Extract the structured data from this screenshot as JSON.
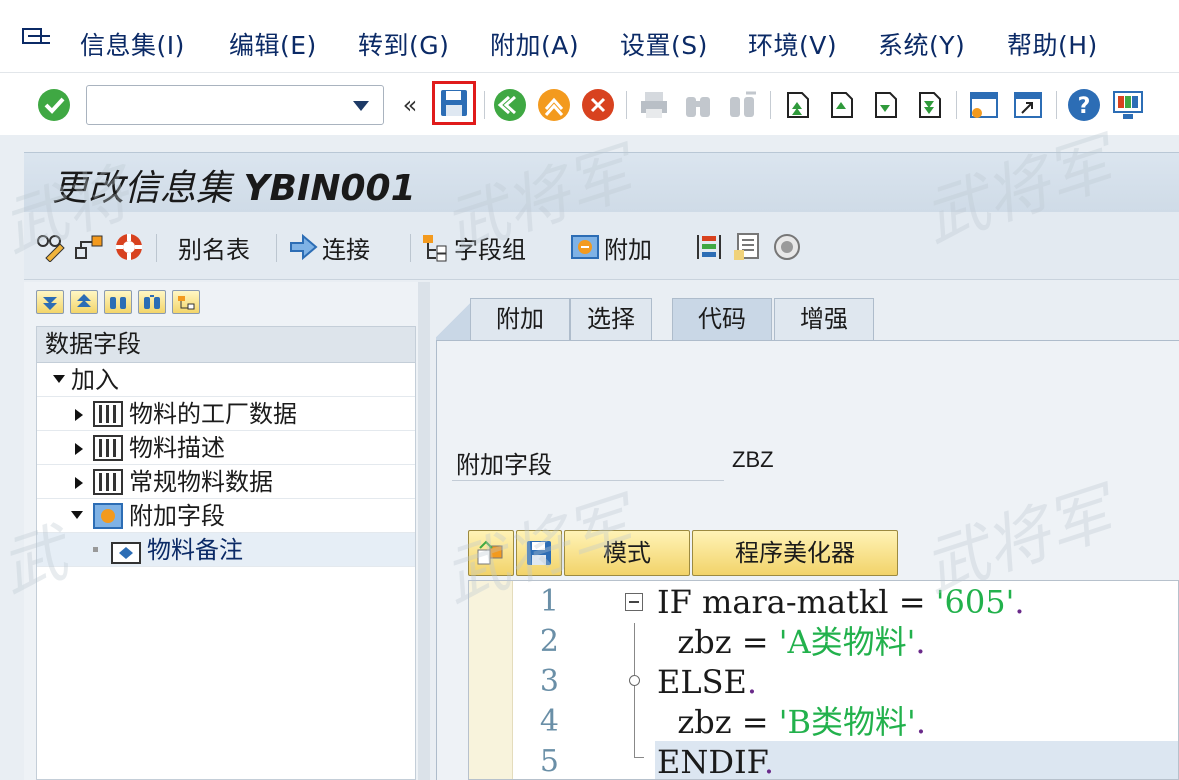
{
  "menu": {
    "items": [
      "信息集(I)",
      "编辑(E)",
      "转到(G)",
      "附加(A)",
      "设置(S)",
      "环境(V)",
      "系统(Y)",
      "帮助(H)"
    ]
  },
  "command_field": {
    "value": ""
  },
  "toolbar": {
    "icons": [
      "enter-icon",
      "save-icon",
      "back-icon",
      "exit-icon",
      "cancel-icon",
      "print-icon",
      "find-icon",
      "find-next-icon",
      "first-page-icon",
      "prev-page-icon",
      "next-page-icon",
      "last-page-icon",
      "new-session-icon",
      "shortcut-icon",
      "help-icon",
      "layout-icon"
    ]
  },
  "page": {
    "title_prefix": "更改信息集",
    "title_name": "YBIN001"
  },
  "app_toolbar": {
    "alias_table": "别名表",
    "join": "连接",
    "field_groups": "字段组",
    "extras": "附加"
  },
  "tree": {
    "header": "数据字段",
    "root": "加入",
    "children": [
      {
        "label": "物料的工厂数据",
        "expanded": false
      },
      {
        "label": "物料描述",
        "expanded": false
      },
      {
        "label": "常规物料数据",
        "expanded": false
      },
      {
        "label": "附加字段",
        "expanded": true
      }
    ],
    "leaf": "物料备注"
  },
  "tabs": [
    "附加",
    "选择",
    "代码",
    "增强"
  ],
  "active_tab": "代码",
  "extra_field": {
    "label": "附加字段",
    "value": "ZBZ"
  },
  "editor_toolbar": {
    "mode": "模式",
    "pretty_printer": "程序美化器"
  },
  "code": {
    "lines": [
      {
        "num": "1",
        "parts": [
          [
            "kw",
            "IF mara-matkl = "
          ],
          [
            "str",
            "'605'"
          ],
          [
            "dot",
            "."
          ]
        ]
      },
      {
        "num": "2",
        "parts": [
          [
            "kw",
            "  zbz = "
          ],
          [
            "str",
            "'A类物料'"
          ],
          [
            "dot",
            "."
          ]
        ]
      },
      {
        "num": "3",
        "parts": [
          [
            "kw",
            "ELSE"
          ],
          [
            "dot",
            "."
          ]
        ]
      },
      {
        "num": "4",
        "parts": [
          [
            "kw",
            "  zbz = "
          ],
          [
            "str",
            "'B类物料'"
          ],
          [
            "dot",
            "."
          ]
        ]
      },
      {
        "num": "5",
        "parts": [
          [
            "kw",
            "ENDIF"
          ],
          [
            "dot",
            "."
          ]
        ]
      }
    ],
    "current_line": "5"
  },
  "colors": {
    "string_literal": "#22b14c",
    "line_number": "#6a8fa7",
    "menu_text": "#0b2a66",
    "save_highlight": "#e01b1b"
  }
}
